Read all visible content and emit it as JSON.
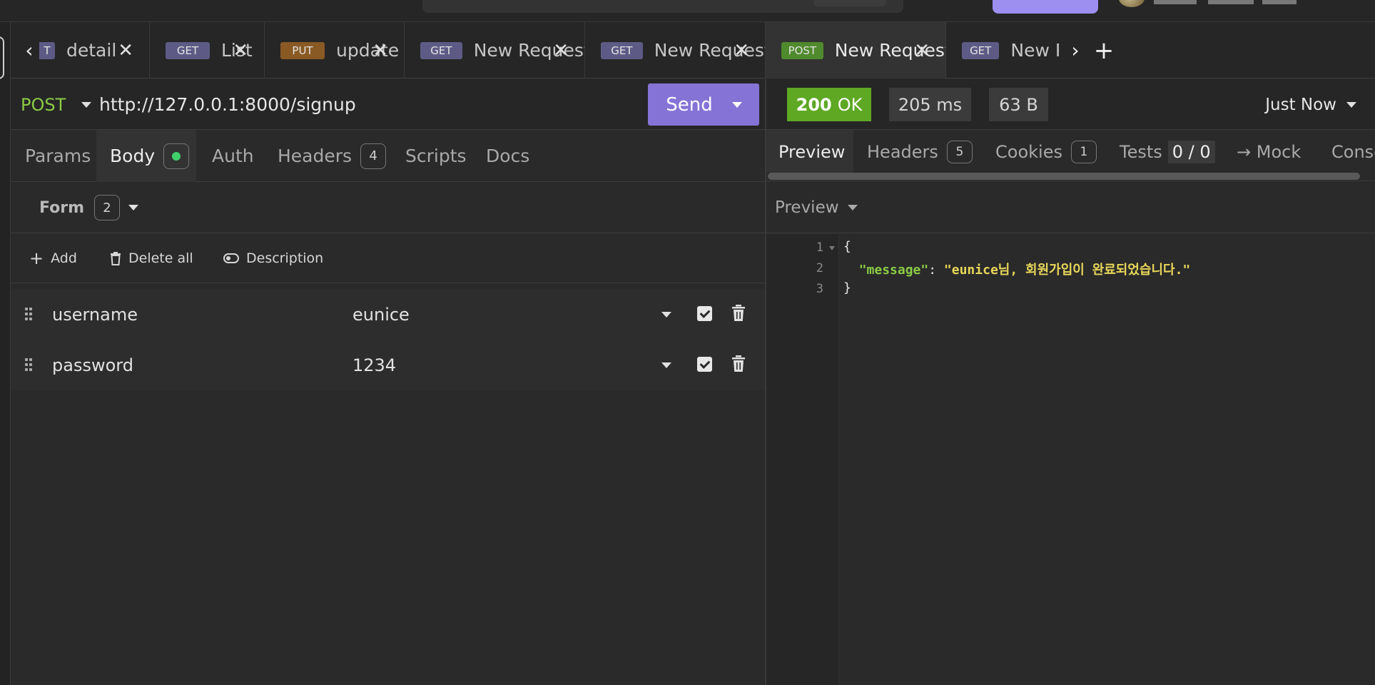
{
  "tabs": [
    {
      "method": "T",
      "name": "detail",
      "close": "✕",
      "methodClass": "m-get"
    },
    {
      "method": "GET",
      "name": "List",
      "close": "✕",
      "methodClass": "m-get"
    },
    {
      "method": "PUT",
      "name": "update",
      "close": "✕",
      "methodClass": "m-put"
    },
    {
      "method": "GET",
      "name": "New Request",
      "close": "✕",
      "methodClass": "m-get"
    },
    {
      "method": "GET",
      "name": "New Request",
      "close": "✕",
      "methodClass": "m-get"
    },
    {
      "method": "POST",
      "name": "New Request",
      "close": "✕",
      "methodClass": "m-post"
    },
    {
      "method": "GET",
      "name": "New Req",
      "close": "",
      "methodClass": "m-get"
    }
  ],
  "tabnav": {
    "prev": "‹",
    "next": "›",
    "add": "+"
  },
  "request": {
    "method": "POST",
    "url": "http://127.0.0.1:8000/signup",
    "send_label": "Send"
  },
  "request_tabs": {
    "params": "Params",
    "body": "Body",
    "auth": "Auth",
    "headers": "Headers",
    "headers_count": "4",
    "scripts": "Scripts",
    "docs": "Docs"
  },
  "form": {
    "label": "Form",
    "count": "2",
    "add": "Add",
    "delete_all": "Delete all",
    "description": "Description",
    "rows": [
      {
        "key": "username",
        "value": "eunice"
      },
      {
        "key": "password",
        "value": "1234"
      }
    ]
  },
  "response": {
    "status_code": "200",
    "status_text": "OK",
    "time": "205 ms",
    "size": "63 B",
    "when": "Just Now",
    "tabs": {
      "preview": "Preview",
      "headers": "Headers",
      "headers_count": "5",
      "cookies": "Cookies",
      "cookies_count": "1",
      "tests": "Tests",
      "tests_count": "0 / 0",
      "mock": "→ Mock",
      "console": "Conso"
    },
    "preview_mode": "Preview",
    "code": {
      "line_numbers": [
        "1",
        "2",
        "3"
      ],
      "open": "{",
      "key": "\"message\"",
      "colon": ": ",
      "value": "\"eunice님, 회원가입이 완료되었습니다.\"",
      "close": "}"
    }
  },
  "colors": {
    "accent": "#8673d6",
    "ok_green": "#5ea824",
    "post_green": "#8acb45",
    "json_string": "#e9d85a"
  }
}
